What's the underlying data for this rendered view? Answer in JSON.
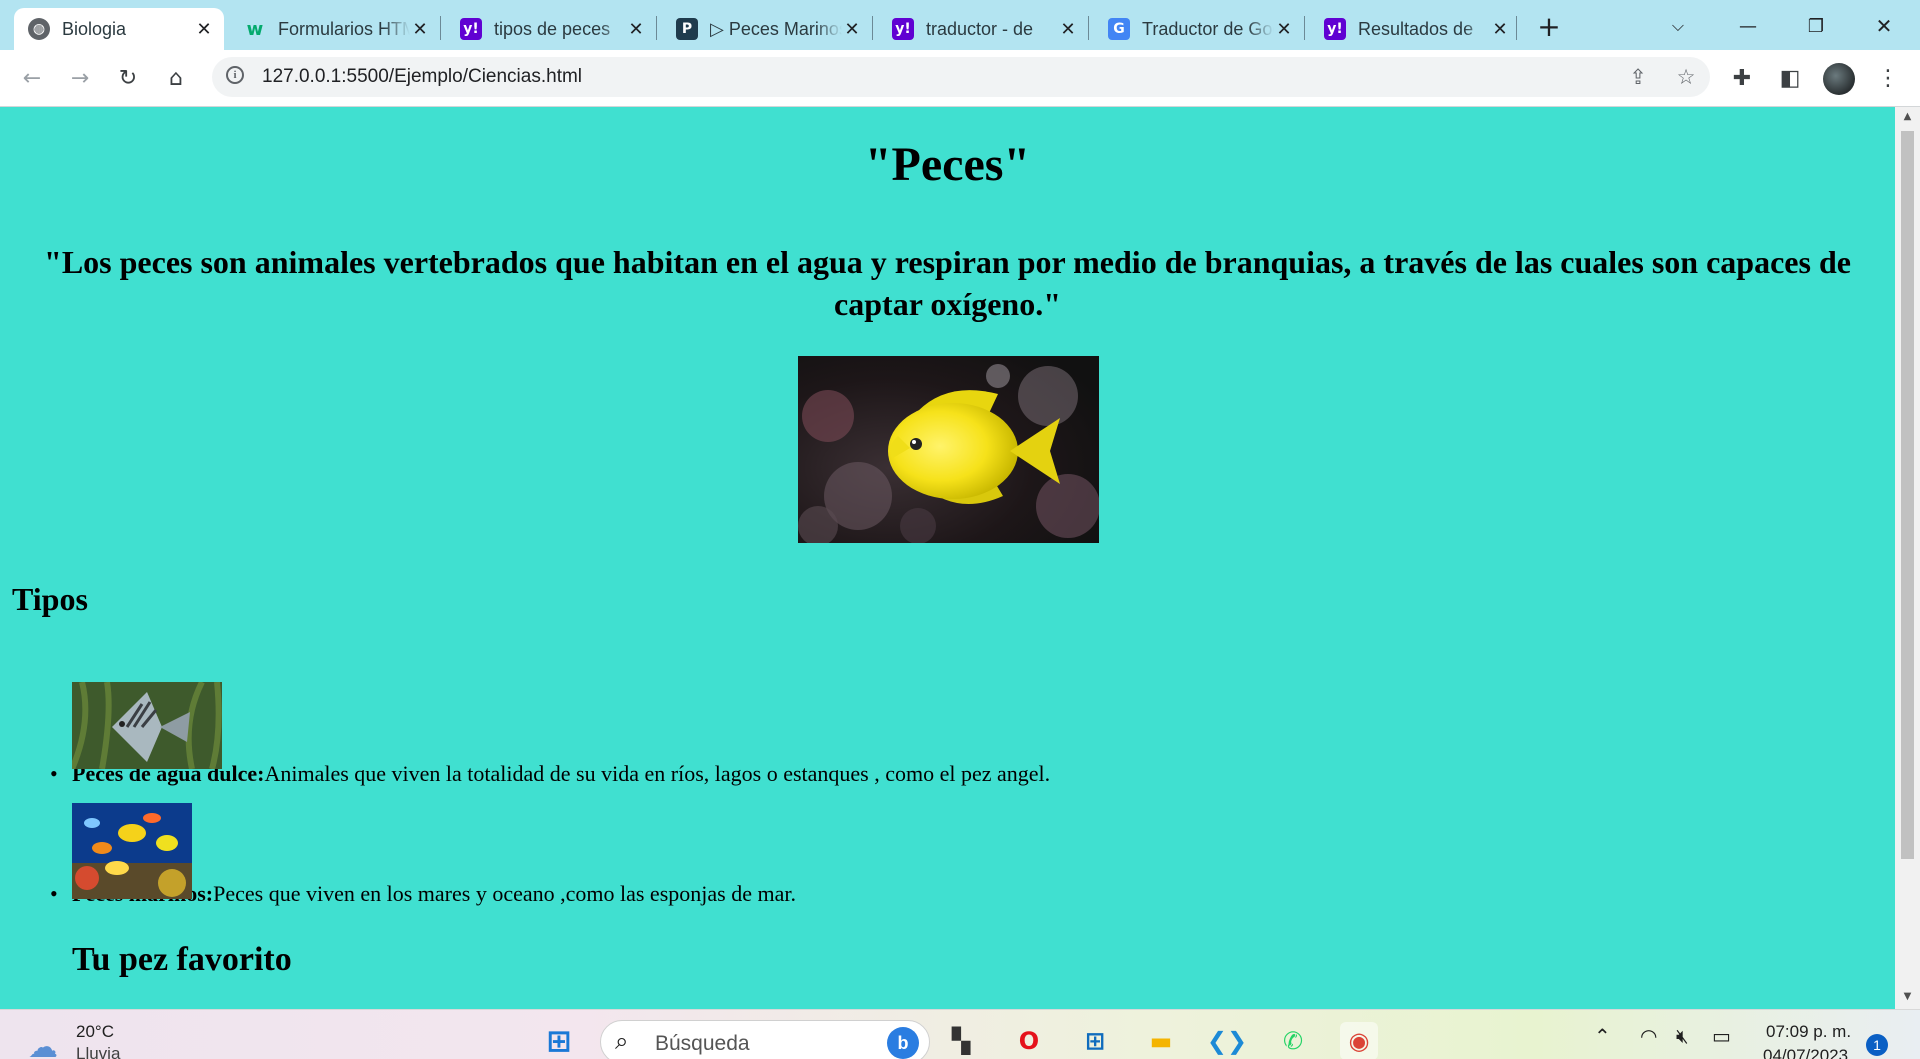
{
  "browser": {
    "tabs": [
      {
        "title": "Biologia",
        "icon": "globe-icon",
        "active": true
      },
      {
        "title": "Formularios HTML",
        "icon": "w3schools-icon",
        "active": false
      },
      {
        "title": "tipos de peces",
        "icon": "yahoo-icon",
        "active": false
      },
      {
        "title": "▷ Peces Marinos",
        "icon": "site-icon",
        "active": false
      },
      {
        "title": "traductor - de",
        "icon": "yahoo-icon",
        "active": false
      },
      {
        "title": "Traductor de Google",
        "icon": "google-translate-icon",
        "active": false
      },
      {
        "title": "Resultados de",
        "icon": "yahoo-icon",
        "active": false
      }
    ],
    "url": "127.0.0.1:5500/Ejemplo/Ciencias.html"
  },
  "page": {
    "title": "\"Peces\"",
    "quote": "\"Los peces son animales vertebrados que habitan en el agua y respiran por medio de branquias, a través de las cuales son capaces de captar oxígeno.\"",
    "hero_image": "yellow-tang-fish",
    "section_title": "Tipos",
    "types": [
      {
        "label": "Peces de agua dulce:",
        "desc": "Animales que viven la totalidad de su vida en ríos, lagos o estanques , como el pez angel.",
        "image": "angelfish"
      },
      {
        "label": "Peces marinos:",
        "desc": "Peces que viven en los mares y oceano ,como las esponjas de mar.",
        "image": "reef-fish"
      }
    ],
    "favorite_heading": "Tu pez favorito",
    "background": "#40e0d0"
  },
  "taskbar": {
    "temperature": "20°C",
    "weather": "Lluvia",
    "search_placeholder": "Búsqueda",
    "time": "07:09 p. m.",
    "date": "04/07/2023",
    "notifications": "1"
  }
}
